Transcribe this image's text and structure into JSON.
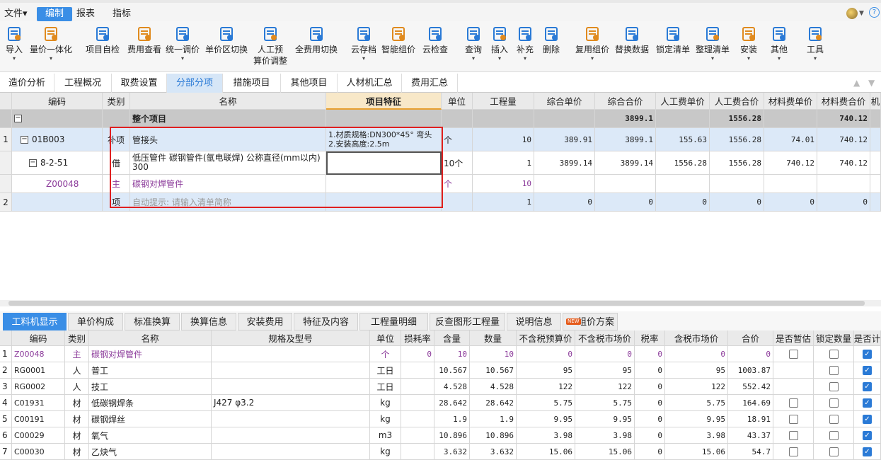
{
  "menubar": {
    "file": "文件▾",
    "edit": "编制",
    "report": "报表",
    "index": "指标"
  },
  "ribbon": [
    {
      "label": "导入",
      "label2": "",
      "icon": "import-icon",
      "dd": true
    },
    {
      "label": "量价一体化",
      "label2": "",
      "icon": "price-volume-icon",
      "dd": true
    },
    {
      "label": "项目自检",
      "label2": "",
      "icon": "project-check-icon",
      "dd": false
    },
    {
      "label": "费用查看",
      "label2": "",
      "icon": "fee-view-icon",
      "dd": false
    },
    {
      "label": "统一调价",
      "label2": "",
      "icon": "unified-price-icon",
      "dd": true
    },
    {
      "label": "单价区切换",
      "label2": "",
      "icon": "unit-price-switch-icon",
      "dd": false
    },
    {
      "label": "人工预",
      "label2": "算价调整",
      "icon": "labor-adjust-icon",
      "dd": false
    },
    {
      "label": "全费用切换",
      "label2": "",
      "icon": "full-fee-switch-icon",
      "dd": false
    },
    {
      "label": "云存档",
      "label2": "",
      "icon": "cloud-archive-icon",
      "dd": true
    },
    {
      "label": "智能组价",
      "label2": "",
      "icon": "smart-price-icon",
      "dd": false
    },
    {
      "label": "云检查",
      "label2": "",
      "icon": "cloud-check-icon",
      "dd": false
    },
    {
      "label": "查询",
      "label2": "",
      "icon": "query-icon",
      "dd": true
    },
    {
      "label": "插入",
      "label2": "",
      "icon": "insert-icon",
      "dd": true
    },
    {
      "label": "补充",
      "label2": "",
      "icon": "supplement-icon",
      "dd": true
    },
    {
      "label": "删除",
      "label2": "",
      "icon": "delete-icon",
      "dd": false
    },
    {
      "label": "复用组价",
      "label2": "",
      "icon": "reuse-price-icon",
      "dd": true
    },
    {
      "label": "替换数据",
      "label2": "",
      "icon": "replace-data-icon",
      "dd": false
    },
    {
      "label": "锁定清单",
      "label2": "",
      "icon": "lock-list-icon",
      "dd": false
    },
    {
      "label": "整理清单",
      "label2": "",
      "icon": "organize-list-icon",
      "dd": true
    },
    {
      "label": "安装",
      "label2": "",
      "icon": "install-icon",
      "dd": true
    },
    {
      "label": "其他",
      "label2": "",
      "icon": "other-icon",
      "dd": true
    },
    {
      "label": "工具",
      "label2": "",
      "icon": "tools-icon",
      "dd": true
    }
  ],
  "tabs1": [
    "造价分析",
    "工程概况",
    "取费设置",
    "分部分项",
    "措施项目",
    "其他项目",
    "人材机汇总",
    "费用汇总"
  ],
  "grid1": {
    "headers": [
      "编码",
      "类别",
      "名称",
      "项目特征",
      "单位",
      "工程量",
      "综合单价",
      "综合合价",
      "人工费单价",
      "人工费合价",
      "材料费单价",
      "材料费合价",
      "机"
    ],
    "total": {
      "name": "整个项目",
      "zhhj": "3899.1",
      "rghj": "1556.28",
      "clhj": "740.12"
    },
    "rows": [
      {
        "no": "1",
        "code": "01B003",
        "type": "补项",
        "name": "管接头",
        "feat1": "1.材质规格:DN300*45° 弯头",
        "feat2": "2.安装高度:2.5m",
        "unit": "个",
        "qty": "10",
        "zhdj": "389.91",
        "zhhj": "3899.1",
        "rgdj": "155.63",
        "rghj": "1556.28",
        "cldj": "74.01",
        "clhj": "740.12"
      },
      {
        "no": "",
        "code": "8-2-51",
        "type": "借",
        "name": "低压管件 碳钢管件(氩电联焊) 公称直径(mm以内)",
        "name2": "300",
        "unit": "10个",
        "qty": "1",
        "zhdj": "3899.14",
        "zhhj": "3899.14",
        "rgdj": "1556.28",
        "rghj": "1556.28",
        "cldj": "740.12",
        "clhj": "740.12"
      },
      {
        "no": "",
        "code": "Z00048",
        "type": "主",
        "name": "碳钢对焊管件",
        "unit": "个",
        "qty": "10"
      },
      {
        "no": "2",
        "code": "",
        "type": "项",
        "name": "自动提示: 请输入清单简称",
        "unit": "",
        "qty": "1",
        "zhdj": "0",
        "zhhj": "0",
        "rgdj": "0",
        "rghj": "0",
        "cldj": "0",
        "clhj": "0"
      }
    ]
  },
  "tabs2": [
    "工料机显示",
    "单价构成",
    "标准换算",
    "换算信息",
    "安装费用",
    "特征及内容",
    "工程量明细",
    "反查图形工程量",
    "说明信息",
    "组价方案"
  ],
  "new_badge": "NEW",
  "grid2": {
    "headers": [
      "编码",
      "类别",
      "名称",
      "规格及型号",
      "单位",
      "损耗率",
      "含量",
      "数量",
      "不含税预算价",
      "不含税市场价",
      "税率",
      "含税市场价",
      "合价",
      "是否暂估",
      "锁定数量",
      "是否计"
    ],
    "rows": [
      {
        "no": "1",
        "code": "Z00048",
        "type": "主",
        "name": "碳钢对焊管件",
        "spec": "",
        "unit": "个",
        "loss": "0",
        "content": "10",
        "qty": "10",
        "p1": "0",
        "p2": "0",
        "tax": "0",
        "p3": "0",
        "sum": "0",
        "est": false,
        "lock": false,
        "calc": true
      },
      {
        "no": "2",
        "code": "RG0001",
        "type": "人",
        "name": "普工",
        "spec": "",
        "unit": "工日",
        "loss": "",
        "content": "10.567",
        "qty": "10.567",
        "p1": "95",
        "p2": "95",
        "tax": "0",
        "p3": "95",
        "sum": "1003.87",
        "est": null,
        "lock": false,
        "calc": true
      },
      {
        "no": "3",
        "code": "RG0002",
        "type": "人",
        "name": "技工",
        "spec": "",
        "unit": "工日",
        "loss": "",
        "content": "4.528",
        "qty": "4.528",
        "p1": "122",
        "p2": "122",
        "tax": "0",
        "p3": "122",
        "sum": "552.42",
        "est": null,
        "lock": false,
        "calc": true
      },
      {
        "no": "4",
        "code": "C01931",
        "type": "材",
        "name": "低碳钢焊条",
        "spec": "J427 φ3.2",
        "unit": "kg",
        "loss": "",
        "content": "28.642",
        "qty": "28.642",
        "p1": "5.75",
        "p2": "5.75",
        "tax": "0",
        "p3": "5.75",
        "sum": "164.69",
        "est": false,
        "lock": false,
        "calc": true
      },
      {
        "no": "5",
        "code": "C00191",
        "type": "材",
        "name": "碳钢焊丝",
        "spec": "",
        "unit": "kg",
        "loss": "",
        "content": "1.9",
        "qty": "1.9",
        "p1": "9.95",
        "p2": "9.95",
        "tax": "0",
        "p3": "9.95",
        "sum": "18.91",
        "est": false,
        "lock": false,
        "calc": true
      },
      {
        "no": "6",
        "code": "C00029",
        "type": "材",
        "name": "氧气",
        "spec": "",
        "unit": "m3",
        "loss": "",
        "content": "10.896",
        "qty": "10.896",
        "p1": "3.98",
        "p2": "3.98",
        "tax": "0",
        "p3": "3.98",
        "sum": "43.37",
        "est": false,
        "lock": false,
        "calc": true
      },
      {
        "no": "7",
        "code": "C00030",
        "type": "材",
        "name": "乙炔气",
        "spec": "",
        "unit": "kg",
        "loss": "",
        "content": "3.632",
        "qty": "3.632",
        "p1": "15.06",
        "p2": "15.06",
        "tax": "0",
        "p3": "15.06",
        "sum": "54.7",
        "est": false,
        "lock": false,
        "calc": true
      }
    ]
  },
  "colors": {
    "accent": "#3a8ee6",
    "highlight_row": "#dce9f8",
    "total_row": "#c8c8c8",
    "red_box": "#e02020",
    "main_item": "#8b3a9a"
  }
}
